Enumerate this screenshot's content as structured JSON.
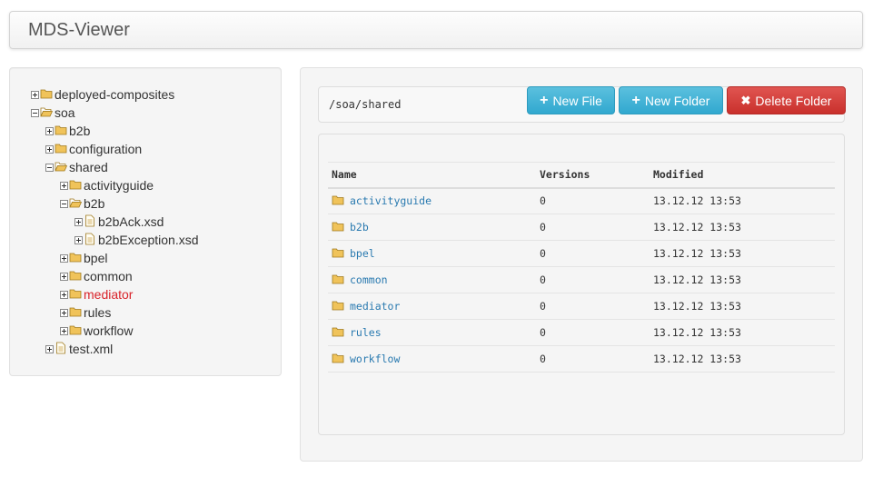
{
  "app": {
    "title": "MDS-Viewer"
  },
  "tree": [
    {
      "label": "deployed-composites",
      "level": 0,
      "expander": "plus",
      "icon": "folder-icon",
      "active": false
    },
    {
      "label": "soa",
      "level": 0,
      "expander": "minus",
      "icon": "folder-open-icon",
      "active": false
    },
    {
      "label": "b2b",
      "level": 1,
      "expander": "plus",
      "icon": "folder-icon",
      "active": false
    },
    {
      "label": "configuration",
      "level": 1,
      "expander": "plus",
      "icon": "folder-icon",
      "active": false
    },
    {
      "label": "shared",
      "level": 1,
      "expander": "minus",
      "icon": "folder-open-icon",
      "active": false
    },
    {
      "label": "activityguide",
      "level": 2,
      "expander": "plus",
      "icon": "folder-icon",
      "active": false
    },
    {
      "label": "b2b",
      "level": 2,
      "expander": "minus",
      "icon": "folder-open-icon",
      "active": false
    },
    {
      "label": "b2bAck.xsd",
      "level": 3,
      "expander": "plus",
      "icon": "file-icon",
      "active": false
    },
    {
      "label": "b2bException.xsd",
      "level": 3,
      "expander": "plus",
      "icon": "file-icon",
      "active": false
    },
    {
      "label": "bpel",
      "level": 2,
      "expander": "plus",
      "icon": "folder-icon",
      "active": false
    },
    {
      "label": "common",
      "level": 2,
      "expander": "plus",
      "icon": "folder-icon",
      "active": false
    },
    {
      "label": "mediator",
      "level": 2,
      "expander": "plus",
      "icon": "folder-icon",
      "active": true
    },
    {
      "label": "rules",
      "level": 2,
      "expander": "plus",
      "icon": "folder-icon",
      "active": false
    },
    {
      "label": "workflow",
      "level": 2,
      "expander": "plus",
      "icon": "folder-icon",
      "active": false
    },
    {
      "label": "test.xml",
      "level": 1,
      "expander": "plus",
      "icon": "file-icon",
      "active": false
    }
  ],
  "path": "/soa/shared",
  "buttons": {
    "new_file": {
      "label": "New File",
      "icon": "plus-icon"
    },
    "new_folder": {
      "label": "New Folder",
      "icon": "plus-icon"
    },
    "delete_folder": {
      "label": "Delete Folder",
      "icon": "close-icon"
    }
  },
  "table": {
    "columns": [
      "Name",
      "Versions",
      "Modified"
    ],
    "rows": [
      {
        "name": "activityguide",
        "versions": "0",
        "modified": "13.12.12 13:53"
      },
      {
        "name": "b2b",
        "versions": "0",
        "modified": "13.12.12 13:53"
      },
      {
        "name": "bpel",
        "versions": "0",
        "modified": "13.12.12 13:53"
      },
      {
        "name": "common",
        "versions": "0",
        "modified": "13.12.12 13:53"
      },
      {
        "name": "mediator",
        "versions": "0",
        "modified": "13.12.12 13:53"
      },
      {
        "name": "rules",
        "versions": "0",
        "modified": "13.12.12 13:53"
      },
      {
        "name": "workflow",
        "versions": "0",
        "modified": "13.12.12 13:53"
      }
    ]
  },
  "colors": {
    "folder": "#f0c35a",
    "link": "#2a7ab0",
    "active": "#d9232a",
    "info": "#5bc0de",
    "danger": "#d9534f"
  }
}
